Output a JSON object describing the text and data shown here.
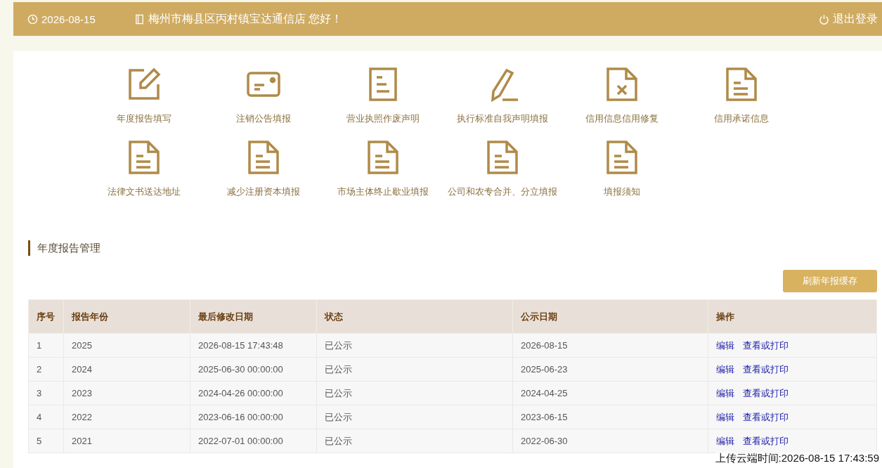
{
  "header": {
    "date": "2026-08-15",
    "greeting": "梅州市梅县区丙村镇宝达通信店 您好！",
    "logout": "退出登录"
  },
  "shortcuts": [
    {
      "label": "年度报告填写",
      "kind": "edit"
    },
    {
      "label": "注销公告填报",
      "kind": "card"
    },
    {
      "label": "营业执照作废声明",
      "kind": "doc"
    },
    {
      "label": "执行标准自我声明填报",
      "kind": "pencil"
    },
    {
      "label": "信用信息信用修复",
      "kind": "docx"
    },
    {
      "label": "信用承诺信息",
      "kind": "doclines"
    },
    {
      "label": "法律文书送达地址",
      "kind": "doclines"
    },
    {
      "label": "减少注册资本填报",
      "kind": "doclines"
    },
    {
      "label": "市场主体终止歇业填报",
      "kind": "doclines"
    },
    {
      "label": "公司和农专合并、分立填报",
      "kind": "doclines"
    },
    {
      "label": "填报须知",
      "kind": "doclines"
    }
  ],
  "section_title": "年度报告管理",
  "refresh_button": "刷新年报缓存",
  "table": {
    "columns": [
      "序号",
      "报告年份",
      "最后修改日期",
      "状态",
      "公示日期",
      "操作"
    ],
    "rows": [
      {
        "no": "1",
        "year": "2025",
        "modified": "2026-08-15 17:43:48",
        "status": "已公示",
        "published": "2026-08-15",
        "actions": [
          "编辑",
          "查看或打印"
        ]
      },
      {
        "no": "2",
        "year": "2024",
        "modified": "2025-06-30 00:00:00",
        "status": "已公示",
        "published": "2025-06-23",
        "actions": [
          "编辑",
          "查看或打印"
        ]
      },
      {
        "no": "3",
        "year": "2023",
        "modified": "2024-04-26 00:00:00",
        "status": "已公示",
        "published": "2024-04-25",
        "actions": [
          "编辑",
          "查看或打印"
        ]
      },
      {
        "no": "4",
        "year": "2022",
        "modified": "2023-06-16 00:00:00",
        "status": "已公示",
        "published": "2023-06-15",
        "actions": [
          "编辑",
          "查看或打印"
        ]
      },
      {
        "no": "5",
        "year": "2021",
        "modified": "2022-07-01 00:00:00",
        "status": "已公示",
        "published": "2022-06-30",
        "actions": [
          "编辑",
          "查看或打印"
        ]
      }
    ]
  },
  "upload_time": "上传云端时间:2026-08-15 17:43:59"
}
